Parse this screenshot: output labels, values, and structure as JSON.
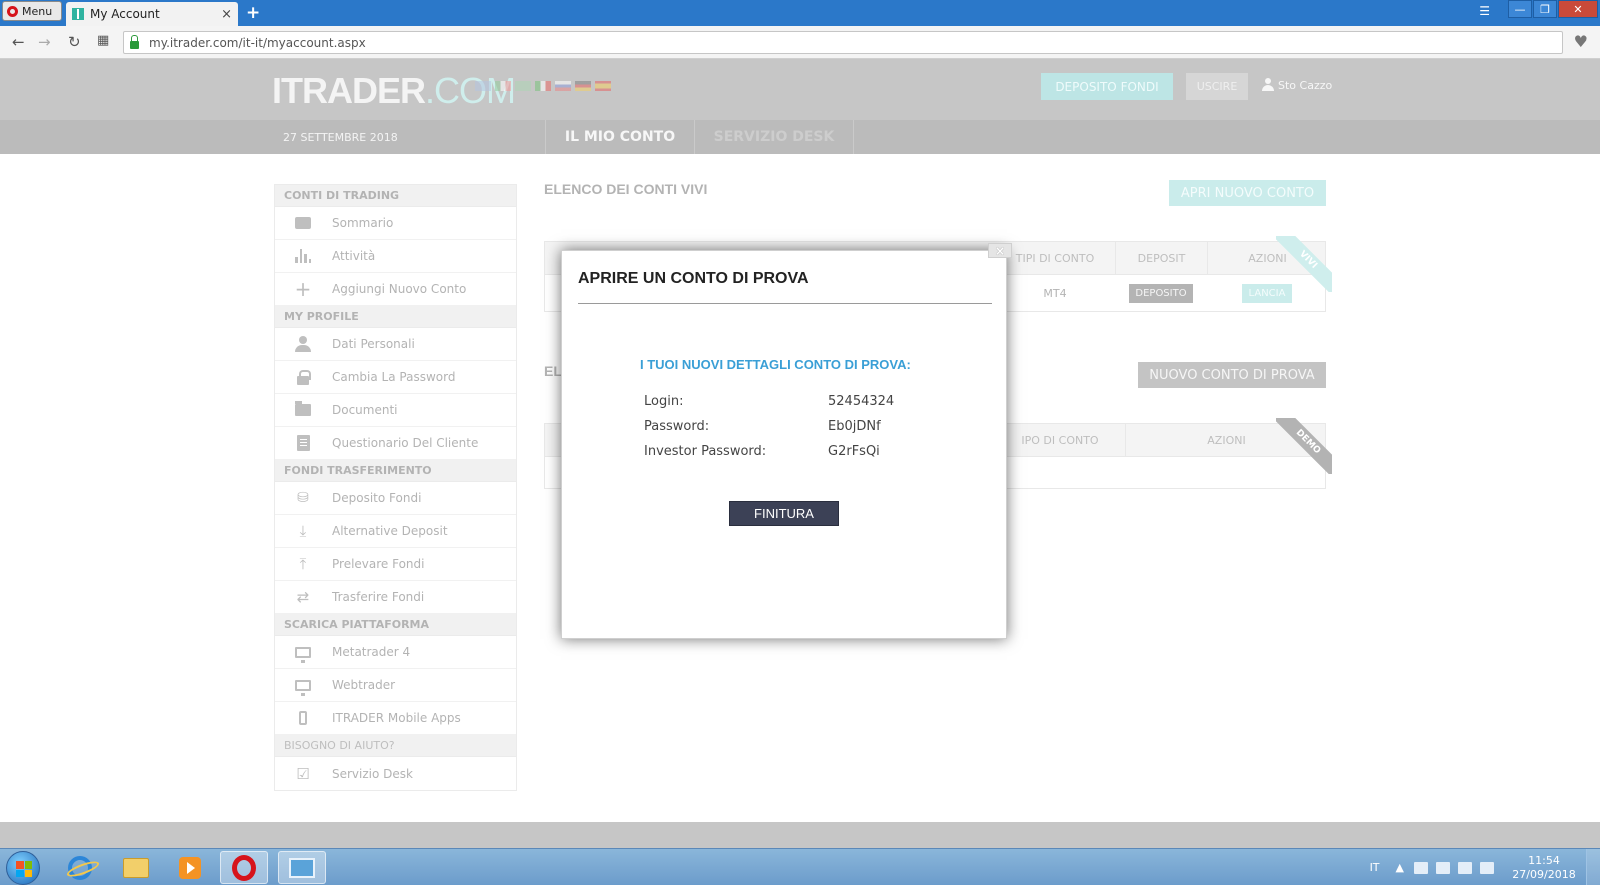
{
  "browser": {
    "menu_label": "Menu",
    "tab_title": "My Account",
    "tab_close": "×",
    "new_tab": "+",
    "url": "my.itrader.com/it-it/myaccount.aspx"
  },
  "header": {
    "logo_main": "ITRADER",
    "logo_suffix": ".COM",
    "deposit_button": "DEPOSITO FONDI",
    "logout_button": "USCIRE",
    "user_name": "Sto Cazzo"
  },
  "nav": {
    "date": "27 SETTEMBRE 2018",
    "tabs": [
      {
        "label": "IL MIO CONTO",
        "active": true
      },
      {
        "label": "SERVIZIO DESK",
        "active": false
      }
    ]
  },
  "sidebar": {
    "sections": [
      {
        "title": "CONTI DI TRADING",
        "items": [
          "Sommario",
          "Attività",
          "Aggiungi Nuovo Conto"
        ]
      },
      {
        "title": "MY PROFILE",
        "items": [
          "Dati Personali",
          "Cambia La Password",
          "Documenti",
          "Questionario Del Cliente"
        ]
      },
      {
        "title": "FONDI TRASFERIMENTO",
        "items": [
          "Deposito Fondi",
          "Alternative Deposit",
          "Prelevare Fondi",
          "Trasferire Fondi"
        ]
      },
      {
        "title": "SCARICA PIATTAFORMA",
        "items": [
          "Metatrader 4",
          "Webtrader",
          "ITRADER Mobile Apps"
        ]
      },
      {
        "title": "BISOGNO DI AIUTO?",
        "items": [
          "Servizio Desk"
        ]
      }
    ]
  },
  "main": {
    "live_title": "ELENCO DEI CONTI VIVI",
    "open_account_button": "APRI NUOVO CONTO",
    "demo_title": "EL",
    "demo_account_button": "NUOVO CONTO DI PROVA",
    "live_table": {
      "headers": [
        "TIPI DI CONTO",
        "DEPOSIT",
        "AZIONI"
      ],
      "row": {
        "type": "MT4",
        "deposit_button": "DEPOSITO",
        "action_button": "LANCIA"
      },
      "ribbon": "VIVI"
    },
    "demo_table": {
      "headers": [
        "IPO DI CONTO",
        "AZIONI"
      ],
      "ribbon": "DEMO"
    }
  },
  "modal": {
    "close": "×",
    "title": "APRIRE UN CONTO DI PROVA",
    "subtitle": "I TUOI NUOVI DETTAGLI CONTO DI PROVA:",
    "credentials": [
      {
        "label": "Login:",
        "value": "52454324"
      },
      {
        "label": "Password:",
        "value": "Eb0jDNf"
      },
      {
        "label": "Investor Password:",
        "value": "G2rFsQi"
      }
    ],
    "finish_button": "FINITURA"
  },
  "taskbar": {
    "language": "IT",
    "time": "11:54",
    "date": "27/09/2018"
  }
}
